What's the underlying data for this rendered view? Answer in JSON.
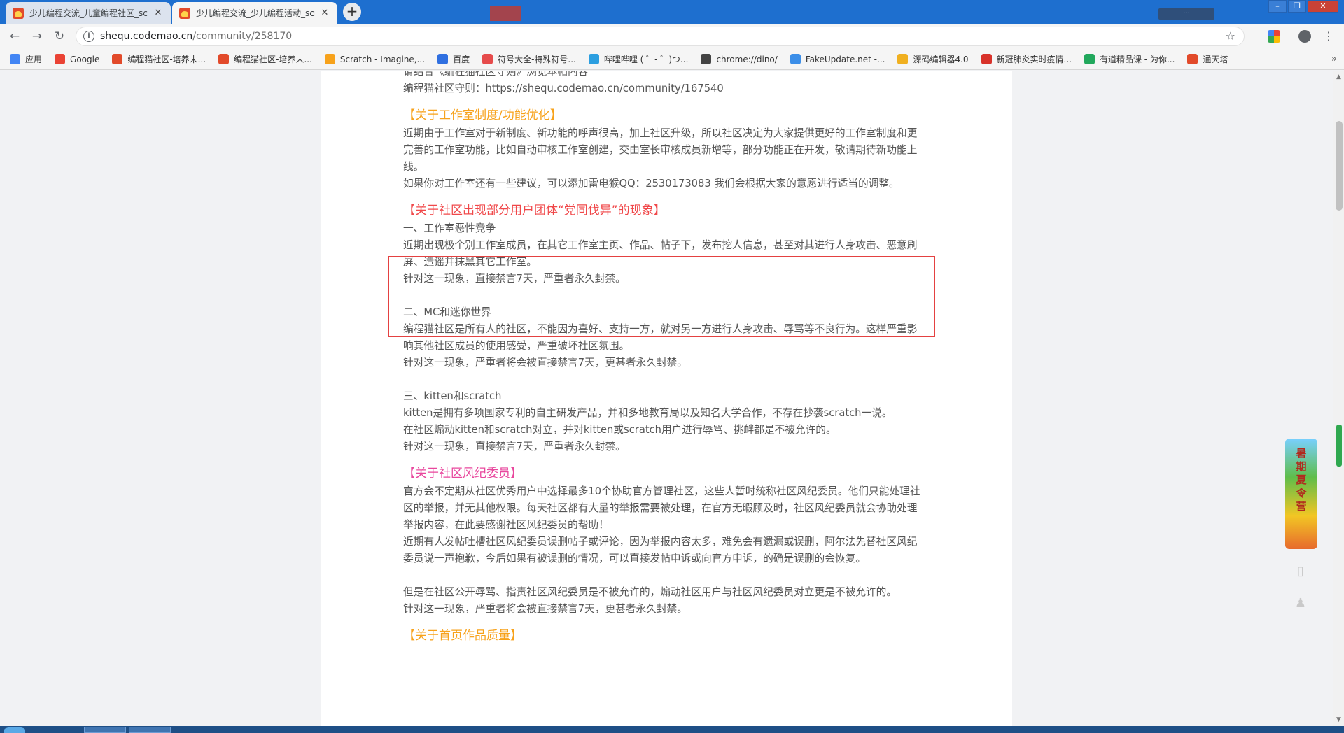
{
  "browser": {
    "tabs": [
      {
        "title": "少儿编程交流_儿童编程社区_sc",
        "active": false
      },
      {
        "title": "少儿编程交流_少儿编程活动_scra",
        "active": true
      }
    ],
    "new_tab_label": "+",
    "url_host": "shequ.codemao.cn",
    "url_path": "/community/258170",
    "bookmarks": [
      {
        "label": "应用",
        "color": "#4285f4"
      },
      {
        "label": "Google",
        "color": "#ea4335"
      },
      {
        "label": "编程猫社区-培养未...",
        "color": "#e24a2a"
      },
      {
        "label": "编程猫社区-培养未...",
        "color": "#e24a2a"
      },
      {
        "label": "Scratch - Imagine,...",
        "color": "#f7a21b"
      },
      {
        "label": "百度",
        "color": "#2f6fe0"
      },
      {
        "label": "符号大全-特殊符号...",
        "color": "#e64b4b"
      },
      {
        "label": "哔哩哔哩 ( ゜- ゜)つ...",
        "color": "#2c9fe0"
      },
      {
        "label": "chrome://dino/",
        "color": "#444444"
      },
      {
        "label": "FakeUpdate.net -...",
        "color": "#3b8ee8"
      },
      {
        "label": "源码编辑器4.0",
        "color": "#f0b020"
      },
      {
        "label": "新冠肺炎实时疫情...",
        "color": "#d8322a"
      },
      {
        "label": "有道精品课 - 为你...",
        "color": "#21a85c"
      },
      {
        "label": "通天塔",
        "color": "#e24a2a"
      }
    ],
    "bookmarks_more": "»"
  },
  "article": {
    "intro_lines": [
      "请结合《编程猫社区守则》浏览本帖内容",
      "编程猫社区守则：https://shequ.codemao.cn/community/167540"
    ],
    "section_studio": {
      "heading": "【关于工作室制度/功能优化】",
      "paragraphs": [
        "近期由于工作室对于新制度、新功能的呼声很高，加上社区升级，所以社区决定为大家提供更好的工作室制度和更完善的工作室功能，比如自动审核工作室创建，交由室长审核成员新增等，部分功能正在开发，敬请期待新功能上线。",
        "如果你对工作室还有一些建议，可以添加雷电猴QQ：2530173083 我们会根据大家的意愿进行适当的调整。"
      ]
    },
    "section_groups": {
      "heading": "【关于社区出现部分用户团体“党同伐异”的现象】",
      "item1_title": "一、工作室恶性竞争",
      "item1_paragraphs": [
        "近期出现极个别工作室成员，在其它工作室主页、作品、帖子下，发布挖人信息，甚至对其进行人身攻击、恶意刷屏、造谣并抹黑其它工作室。",
        "针对这一现象，直接禁言7天，严重者永久封禁。"
      ],
      "item2_title": "二、MC和迷你世界",
      "item2_paragraphs": [
        "编程猫社区是所有人的社区，不能因为喜好、支持一方，就对另一方进行人身攻击、辱骂等不良行为。这样严重影响其他社区成员的使用感受，严重破坏社区氛围。",
        "针对这一现象，严重者将会被直接禁言7天，更甚者永久封禁。"
      ],
      "item3_title": "三、kitten和scratch",
      "item3_paragraphs": [
        "kitten是拥有多项国家专利的自主研发产品，并和多地教育局以及知名大学合作，不存在抄袭scratch一说。",
        "在社区煽动kitten和scratch对立，并对kitten或scratch用户进行辱骂、挑衅都是不被允许的。",
        "针对这一现象，直接禁言7天，严重者永久封禁。"
      ]
    },
    "section_committee": {
      "heading": "【关于社区风纪委员】",
      "paragraphs": [
        "官方会不定期从社区优秀用户中选择最多10个协助官方管理社区，这些人暂时统称社区风纪委员。他们只能处理社区的举报，并无其他权限。每天社区都有大量的举报需要被处理，在官方无暇顾及时，社区风纪委员就会协助处理举报内容，在此要感谢社区风纪委员的帮助！",
        "近期有人发帖吐槽社区风纪委员误删帖子或评论，因为举报内容太多，难免会有遗漏或误删，阿尔法先替社区风纪委员说一声抱歉，今后如果有被误删的情况，可以直接发帖申诉或向官方申诉，的确是误删的会恢复。"
      ],
      "paragraphs_after_gap": [
        "但是在社区公开辱骂、指责社区风纪委员是不被允许的，煽动社区用户与社区风纪委员对立更是不被允许的。",
        "针对这一现象，严重者将会被直接禁言7天，更甚者永久封禁。"
      ]
    },
    "section_homepage": {
      "heading": "【关于首页作品质量】"
    }
  },
  "side": {
    "promo_text": "暑期夏令营",
    "phone_icon": "phone-icon",
    "qq_icon": "qq-penguin-icon"
  }
}
